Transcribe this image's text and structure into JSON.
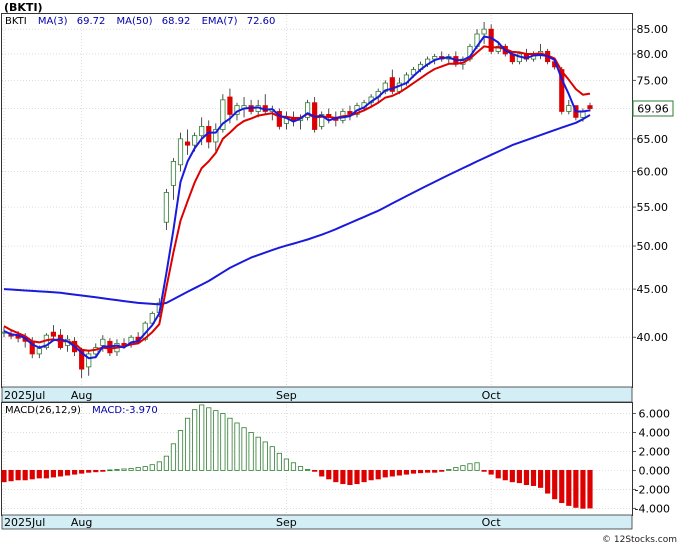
{
  "ticker_label": "(BKTI)",
  "watermark": "© 12Stocks.com",
  "price_panel": {
    "legend": [
      {
        "text": "BKTI",
        "color": "#000000"
      },
      {
        "text": "MA(3)",
        "color": "#0000aa"
      },
      {
        "text": "69.72",
        "color": "#0000aa"
      },
      {
        "text": "MA(50)",
        "color": "#0000aa"
      },
      {
        "text": "68.92",
        "color": "#0000aa"
      },
      {
        "text": "EMA(7)",
        "color": "#0000aa"
      },
      {
        "text": "72.60",
        "color": "#0000aa"
      }
    ],
    "last_price_label": "69.96"
  },
  "macd_panel": {
    "legend": [
      {
        "text": "MACD(26,12,9)",
        "color": "#000000"
      },
      {
        "text": "MACD:-3.970",
        "color": "#0000aa"
      }
    ]
  },
  "colors": {
    "up_candle": "#2e7d32",
    "down_candle": "#dd0000",
    "ma_short": "#1a1adc",
    "ma_long": "#1a1adc",
    "ema": "#dd0000",
    "axis_band": "#d4eef6",
    "macd_pos": "#2e7d32",
    "macd_neg": "#dd0000",
    "price_tag_border": "#2e7d32"
  },
  "chart_data": [
    {
      "type": "candlestick",
      "ylim": [
        35.5,
        88
      ],
      "log_scale": true,
      "y_ticks": [
        "85.00",
        "80.00",
        "75.00",
        "70.00",
        "65.00",
        "60.00",
        "55.00",
        "50.00",
        "45.00",
        "40.00"
      ],
      "y_tick_values": [
        85,
        80,
        75,
        70,
        65,
        60,
        55,
        50,
        45,
        40
      ],
      "x_labels": [
        "2025Jul",
        "Aug",
        "Sep",
        "Oct"
      ],
      "x_label_index": [
        0,
        11,
        40,
        69
      ],
      "n_bars": 84,
      "ohlc": [
        [
          40.5,
          41.0,
          40.0,
          40.5
        ],
        [
          40.3,
          40.8,
          39.8,
          40.1
        ],
        [
          40.1,
          40.6,
          39.5,
          39.9
        ],
        [
          39.9,
          40.4,
          39.0,
          39.6
        ],
        [
          39.6,
          40.0,
          38.0,
          38.4
        ],
        [
          38.4,
          39.2,
          38.0,
          38.9
        ],
        [
          39.0,
          40.4,
          38.8,
          40.2
        ],
        [
          40.5,
          41.2,
          39.8,
          40.1
        ],
        [
          40.2,
          40.8,
          38.8,
          39.0
        ],
        [
          39.2,
          40.2,
          38.6,
          39.8
        ],
        [
          39.6,
          40.0,
          38.2,
          38.6
        ],
        [
          38.8,
          39.0,
          36.2,
          37.0
        ],
        [
          37.2,
          38.8,
          36.4,
          38.4
        ],
        [
          38.4,
          39.4,
          38.0,
          39.0
        ],
        [
          39.2,
          40.2,
          38.6,
          39.8
        ],
        [
          39.6,
          39.9,
          38.2,
          38.5
        ],
        [
          38.6,
          39.8,
          38.2,
          39.4
        ],
        [
          39.4,
          39.9,
          38.9,
          39.2
        ],
        [
          39.3,
          40.2,
          39.0,
          40.0
        ],
        [
          40.0,
          40.5,
          39.4,
          39.7
        ],
        [
          39.8,
          41.6,
          39.6,
          41.4
        ],
        [
          41.4,
          42.6,
          41.2,
          42.4
        ],
        [
          42.5,
          44.0,
          42.0,
          43.5
        ],
        [
          53.0,
          57.5,
          52.0,
          57.0
        ],
        [
          58.0,
          62.0,
          56.0,
          61.5
        ],
        [
          61.0,
          66.0,
          60.0,
          65.0
        ],
        [
          64.5,
          66.5,
          62.5,
          64.0
        ],
        [
          64.0,
          66.0,
          63.0,
          65.5
        ],
        [
          65.5,
          68.5,
          64.0,
          67.0
        ],
        [
          67.0,
          68.0,
          63.5,
          64.5
        ],
        [
          64.5,
          67.5,
          63.0,
          66.5
        ],
        [
          66.5,
          72.5,
          66.0,
          71.5
        ],
        [
          72.0,
          73.5,
          67.5,
          69.0
        ],
        [
          69.0,
          71.0,
          68.0,
          70.5
        ],
        [
          70.0,
          72.0,
          68.5,
          70.5
        ],
        [
          70.5,
          71.5,
          69.0,
          69.5
        ],
        [
          69.5,
          71.5,
          68.5,
          70.5
        ],
        [
          70.5,
          72.5,
          69.0,
          69.5
        ],
        [
          69.5,
          70.5,
          68.0,
          69.8
        ],
        [
          69.5,
          70.0,
          66.5,
          67.0
        ],
        [
          67.5,
          69.5,
          66.5,
          68.5
        ],
        [
          68.5,
          69.5,
          67.0,
          68.0
        ],
        [
          68.0,
          69.0,
          66.5,
          68.5
        ],
        [
          68.5,
          71.5,
          68.0,
          71.0
        ],
        [
          71.0,
          72.0,
          66.0,
          66.5
        ],
        [
          67.0,
          69.5,
          66.5,
          69.0
        ],
        [
          69.0,
          70.0,
          67.5,
          68.5
        ],
        [
          68.5,
          69.5,
          67.0,
          68.0
        ],
        [
          68.0,
          70.0,
          67.5,
          69.5
        ],
        [
          69.5,
          70.5,
          68.0,
          69.0
        ],
        [
          69.0,
          71.0,
          68.5,
          70.5
        ],
        [
          70.0,
          71.5,
          69.5,
          71.0
        ],
        [
          71.0,
          72.5,
          70.5,
          72.0
        ],
        [
          72.0,
          73.5,
          71.0,
          73.0
        ],
        [
          73.0,
          75.0,
          72.5,
          74.5
        ],
        [
          75.5,
          77.0,
          72.5,
          73.0
        ],
        [
          73.0,
          75.5,
          72.5,
          74.5
        ],
        [
          74.5,
          76.5,
          74.0,
          76.0
        ],
        [
          76.0,
          77.5,
          75.5,
          77.0
        ],
        [
          77.0,
          78.5,
          76.5,
          78.0
        ],
        [
          78.0,
          79.5,
          77.5,
          79.0
        ],
        [
          79.0,
          80.0,
          78.0,
          79.5
        ],
        [
          79.5,
          80.5,
          78.5,
          79.0
        ],
        [
          79.0,
          80.0,
          78.0,
          79.5
        ],
        [
          79.5,
          80.5,
          77.5,
          78.0
        ],
        [
          78.0,
          79.5,
          77.0,
          79.0
        ],
        [
          79.0,
          82.0,
          78.5,
          81.5
        ],
        [
          81.5,
          85.0,
          81.0,
          84.0
        ],
        [
          84.0,
          86.5,
          82.0,
          85.0
        ],
        [
          85.0,
          86.0,
          80.0,
          80.5
        ],
        [
          80.5,
          82.5,
          80.0,
          81.5
        ],
        [
          81.5,
          82.0,
          79.5,
          80.0
        ],
        [
          80.0,
          80.5,
          78.0,
          78.5
        ],
        [
          78.5,
          80.5,
          78.0,
          80.0
        ],
        [
          80.0,
          81.0,
          78.5,
          79.0
        ],
        [
          79.0,
          80.5,
          78.5,
          80.0
        ],
        [
          80.0,
          82.0,
          79.0,
          80.5
        ],
        [
          80.5,
          81.0,
          78.0,
          78.5
        ],
        [
          78.5,
          79.0,
          77.0,
          77.5
        ],
        [
          77.0,
          77.5,
          69.0,
          69.5
        ],
        [
          69.5,
          71.5,
          69.0,
          70.5
        ],
        [
          70.5,
          70.5,
          68.0,
          68.5
        ],
        [
          68.5,
          70.0,
          67.8,
          69.5
        ],
        [
          70.5,
          71.0,
          69.5,
          70.0
        ]
      ],
      "ema7": [
        41.1,
        40.7,
        40.4,
        40.1,
        39.6,
        39.5,
        39.7,
        39.8,
        39.6,
        39.6,
        39.4,
        38.8,
        38.7,
        38.8,
        39.0,
        38.9,
        39.0,
        39.1,
        39.3,
        39.4,
        39.9,
        40.5,
        41.3,
        45.2,
        49.2,
        53.2,
        55.8,
        58.4,
        60.5,
        61.5,
        62.8,
        65.0,
        66.0,
        67.1,
        67.9,
        68.3,
        68.8,
        69.0,
        69.2,
        68.6,
        68.6,
        68.4,
        68.4,
        69.1,
        68.5,
        68.6,
        68.6,
        68.4,
        68.7,
        68.8,
        69.2,
        69.7,
        70.3,
        71.0,
        71.9,
        72.2,
        72.8,
        73.6,
        74.5,
        75.4,
        76.3,
        77.1,
        77.6,
        78.1,
        78.1,
        78.3,
        79.1,
        80.3,
        81.5,
        81.3,
        81.3,
        81.0,
        80.4,
        80.3,
        80.0,
        80.0,
        80.1,
        79.7,
        79.1,
        76.7,
        75.1,
        73.4,
        72.4,
        72.6
      ],
      "ma_short": [
        40.6,
        40.3,
        40.2,
        39.9,
        39.3,
        39.0,
        39.2,
        39.7,
        39.8,
        39.6,
        39.1,
        38.5,
        38.0,
        38.1,
        39.1,
        39.1,
        39.2,
        39.0,
        39.5,
        39.6,
        40.4,
        41.2,
        42.4,
        46.8,
        52.0,
        58.5,
        61.5,
        63.5,
        65.0,
        66.0,
        66.0,
        67.5,
        68.3,
        69.5,
        70.0,
        70.1,
        70.2,
        69.8,
        69.9,
        68.8,
        68.4,
        67.8,
        68.3,
        69.2,
        68.6,
        68.8,
        68.0,
        68.4,
        68.5,
        68.7,
        69.7,
        70.2,
        71.2,
        72.0,
        73.2,
        73.5,
        74.0,
        74.5,
        75.8,
        77.0,
        78.0,
        78.8,
        79.2,
        79.3,
        78.8,
        78.8,
        79.5,
        81.5,
        83.5,
        83.2,
        82.3,
        80.7,
        80.0,
        79.5,
        79.2,
        79.7,
        79.8,
        79.6,
        78.8,
        75.2,
        72.5,
        69.5,
        69.5,
        69.7
      ],
      "ma50": [
        45.0,
        44.95,
        44.9,
        44.85,
        44.8,
        44.75,
        44.7,
        44.65,
        44.6,
        44.5,
        44.4,
        44.3,
        44.2,
        44.1,
        44.0,
        43.9,
        43.8,
        43.7,
        43.6,
        43.5,
        43.45,
        43.4,
        43.35,
        43.5,
        43.9,
        44.3,
        44.7,
        45.1,
        45.5,
        45.9,
        46.4,
        46.9,
        47.4,
        47.8,
        48.2,
        48.6,
        48.9,
        49.2,
        49.5,
        49.8,
        50.05,
        50.3,
        50.55,
        50.8,
        51.1,
        51.4,
        51.75,
        52.1,
        52.5,
        52.9,
        53.3,
        53.7,
        54.1,
        54.5,
        55.0,
        55.5,
        56.0,
        56.5,
        57.0,
        57.5,
        58.0,
        58.5,
        59.0,
        59.5,
        60.0,
        60.5,
        61.0,
        61.5,
        62.0,
        62.5,
        63.0,
        63.5,
        64.0,
        64.4,
        64.8,
        65.2,
        65.6,
        66.0,
        66.4,
        66.8,
        67.2,
        67.6,
        68.2,
        68.9
      ]
    },
    {
      "type": "bar",
      "ylim": [
        -4.6,
        7.0
      ],
      "y_ticks": [
        "6.000",
        "4.000",
        "2.000",
        "0.000",
        "-2.000",
        "-4.000"
      ],
      "y_tick_values": [
        6,
        4,
        2,
        0,
        -2,
        -4
      ],
      "x_labels": [
        "2025Jul",
        "Aug",
        "Sep",
        "Oct"
      ],
      "x_label_index": [
        0,
        11,
        40,
        69
      ],
      "values": [
        -1.2,
        -1.1,
        -1.0,
        -1.0,
        -0.9,
        -0.8,
        -0.8,
        -0.7,
        -0.6,
        -0.5,
        -0.4,
        -0.3,
        -0.2,
        -0.15,
        -0.1,
        0.05,
        0.1,
        0.15,
        0.2,
        0.3,
        0.4,
        0.6,
        0.9,
        1.5,
        2.8,
        4.2,
        5.5,
        6.4,
        6.9,
        6.6,
        6.3,
        6.0,
        5.5,
        5.0,
        4.5,
        4.0,
        3.5,
        3.0,
        2.5,
        1.8,
        1.2,
        0.8,
        0.4,
        0.1,
        -0.1,
        -0.6,
        -0.9,
        -1.2,
        -1.4,
        -1.5,
        -1.4,
        -1.2,
        -1.0,
        -0.9,
        -0.7,
        -0.6,
        -0.5,
        -0.4,
        -0.3,
        -0.25,
        -0.2,
        -0.2,
        -0.1,
        0.1,
        0.3,
        0.5,
        0.7,
        0.8,
        -0.1,
        -0.4,
        -0.8,
        -1.0,
        -1.2,
        -1.3,
        -1.5,
        -1.6,
        -1.8,
        -2.4,
        -3.0,
        -3.4,
        -3.7,
        -3.9,
        -4.0,
        -3.97
      ]
    }
  ]
}
